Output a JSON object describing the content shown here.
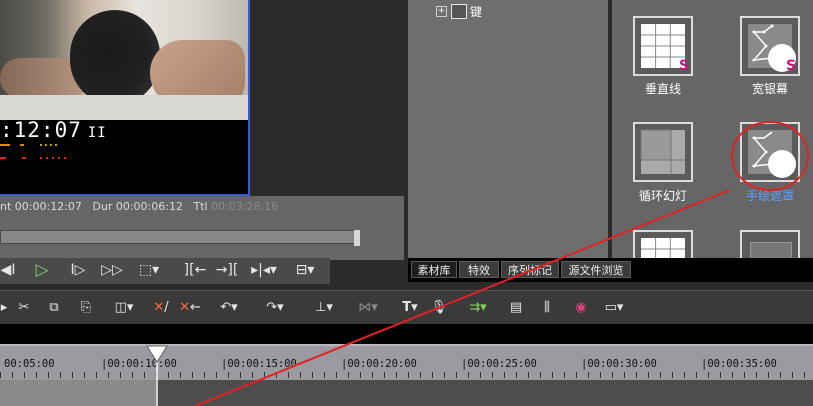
{
  "preview": {
    "timecode": ":12:07",
    "pause_symbol": "II",
    "stats": {
      "in_label": "nt 00:00:12:07",
      "dur_label": "Dur 00:00:06:12",
      "ttl_label": "Ttl",
      "ttl_value": "00:03:28:16"
    },
    "scrub_progress": 0.88
  },
  "tree": {
    "expand_symbol": "+",
    "item_label": "键"
  },
  "thumbnails": [
    {
      "label": "垂直线",
      "icon": "grid-icon",
      "badge": "S"
    },
    {
      "label": "宽银幕",
      "icon": "mask-curve-icon",
      "badge": "S"
    },
    {
      "label": "循环幻灯",
      "icon": "layout-icon"
    },
    {
      "label": "手绘遮罩",
      "icon": "mask-curve-icon",
      "highlighted": true
    }
  ],
  "tabs": [
    "素材库",
    "特效",
    "序列标记",
    "源文件浏览"
  ],
  "timeline": {
    "ticks": [
      "00:05:00",
      "|00:00:10:00",
      "|00:00:15:00",
      "|00:00:20:00",
      "|00:00:25:00",
      "|00:00:30:00",
      "|00:00:35:00"
    ]
  },
  "colors": {
    "accent_red": "#e22222",
    "preview_border": "#3b5bd6",
    "badge": "#c8127f"
  }
}
